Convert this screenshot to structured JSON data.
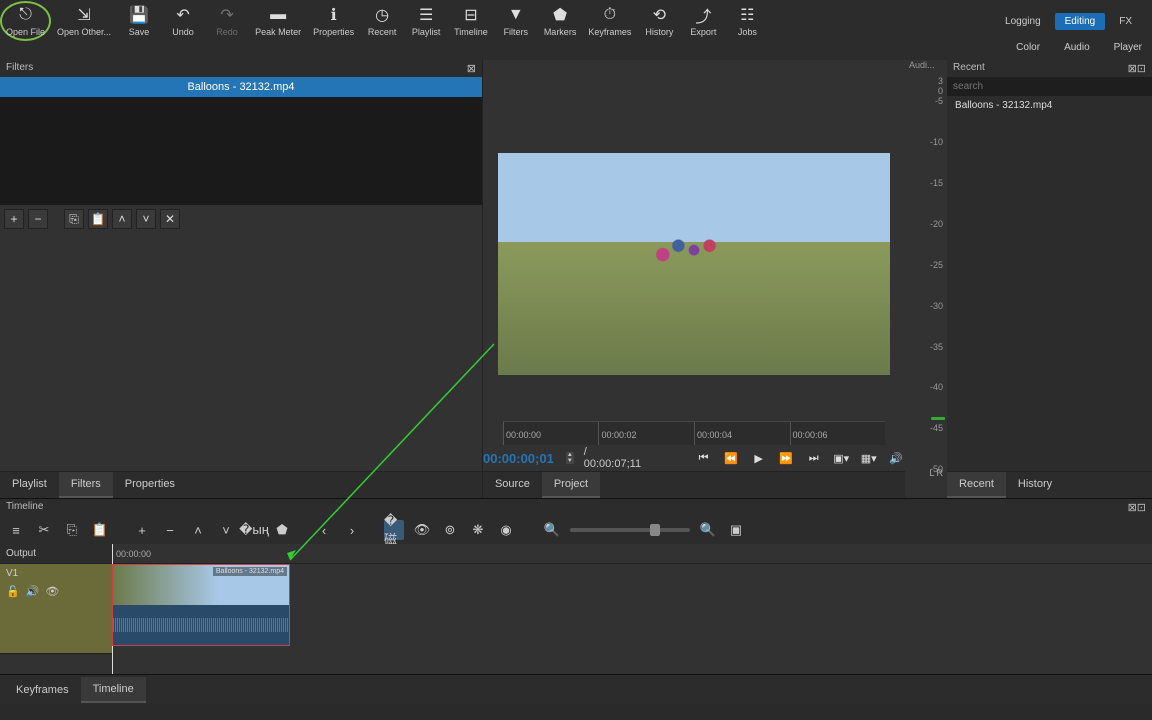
{
  "toolbar": {
    "open_file": "Open File",
    "open_other": "Open Other...",
    "save": "Save",
    "undo": "Undo",
    "redo": "Redo",
    "peak_meter": "Peak Meter",
    "properties": "Properties",
    "recent": "Recent",
    "playlist": "Playlist",
    "timeline": "Timeline",
    "filters": "Filters",
    "markers": "Markers",
    "keyframes": "Keyframes",
    "history": "History",
    "export": "Export",
    "jobs": "Jobs"
  },
  "top_tabs": {
    "logging": "Logging",
    "editing": "Editing",
    "fx": "FX"
  },
  "sub_tabs": {
    "color": "Color",
    "audio": "Audio",
    "player": "Player"
  },
  "filters_panel": {
    "title": "Filters",
    "clip_name": "Balloons - 32132.mp4"
  },
  "left_tabs": {
    "playlist": "Playlist",
    "filters": "Filters",
    "properties": "Properties"
  },
  "preview": {
    "ruler": [
      "00:00:00",
      "00:00:02",
      "00:00:04",
      "00:00:06"
    ],
    "timecode": "00:00:00;01",
    "duration": "/ 00:00:07;11"
  },
  "center_tabs": {
    "source": "Source",
    "project": "Project"
  },
  "audio_meter": {
    "title": "Audi...",
    "top_vals": [
      "3",
      "0"
    ],
    "db": [
      "-5",
      "-10",
      "-15",
      "-20",
      "-25",
      "-30",
      "-35",
      "-40",
      "-45",
      "-50"
    ],
    "lr": "L   R"
  },
  "recent_panel": {
    "title": "Recent",
    "search_placeholder": "search",
    "items": [
      "Balloons - 32132.mp4"
    ]
  },
  "right_tabs": {
    "recent": "Recent",
    "history": "History"
  },
  "timeline": {
    "title": "Timeline",
    "output": "Output",
    "v1": "V1",
    "ruler_start": "00:00:00",
    "clip_label": "Balloons - 32132.mp4"
  },
  "bottom_tabs": {
    "keyframes": "Keyframes",
    "timeline": "Timeline"
  }
}
